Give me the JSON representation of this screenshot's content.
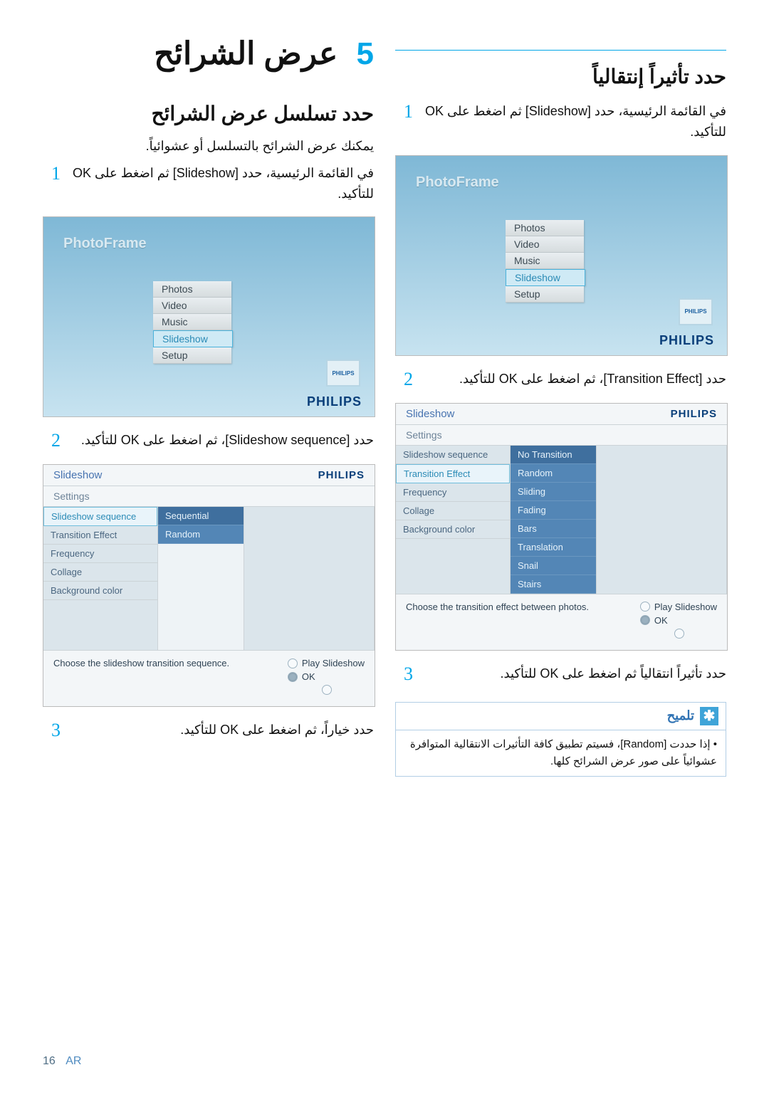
{
  "page_number": "16",
  "lang_label": "AR",
  "chapter": {
    "num": "5",
    "title": "عرض الشرائح"
  },
  "left": {
    "heading": "حدد تسلسل عرض الشرائح",
    "intro": "يمكنك عرض الشرائح بالتسلسل أو عشوائياً.",
    "step1": "في القائمة الرئيسية، حدد [Slideshow] ثم اضغط على OK للتأكيد.",
    "step2": "حدد [Slideshow sequence]، ثم اضغط على OK للتأكيد.",
    "step3": "حدد خياراً، ثم اضغط على OK للتأكيد."
  },
  "right": {
    "heading": "حدد تأثيراً إنتقالياً",
    "step1": "في القائمة الرئيسية، حدد [Slideshow] ثم اضغط على OK للتأكيد.",
    "step2": "حدد [Transition Effect]، ثم اضغط على OK للتأكيد.",
    "step3": "حدد تأثيراً انتقالياً ثم اضغط على OK للتأكيد.",
    "tip_title": "تلميح",
    "tip_body": "إذا حددت [Random]، فسيتم تطبيق كافة التأثيرات الانتقالية المتوافرة عشوائياً على صور عرض الشرائح كلها."
  },
  "pf": {
    "title": "PhotoFrame",
    "items": [
      "Photos",
      "Video",
      "Music",
      "Slideshow",
      "Setup"
    ],
    "brand": "PHILIPS",
    "mini": "PHILIPS"
  },
  "ss_seq": {
    "head": "Slideshow",
    "sub": "Settings",
    "colA": [
      "Slideshow sequence",
      "Transition Effect",
      "Frequency",
      "Collage",
      "Background color"
    ],
    "colB": [
      "Sequential",
      "Random"
    ],
    "foot_text": "Choose the slideshow transition sequence.",
    "play": "Play Slideshow",
    "ok": "OK"
  },
  "ss_eff": {
    "head": "Slideshow",
    "sub": "Settings",
    "colA": [
      "Slideshow sequence",
      "Transition Effect",
      "Frequency",
      "Collage",
      "Background color"
    ],
    "colB": [
      "No Transition",
      "Random",
      "Sliding",
      "Fading",
      "Bars",
      "Translation",
      "Snail",
      "Stairs"
    ],
    "foot_text": "Choose the transition effect between photos.",
    "play": "Play Slideshow",
    "ok": "OK"
  }
}
